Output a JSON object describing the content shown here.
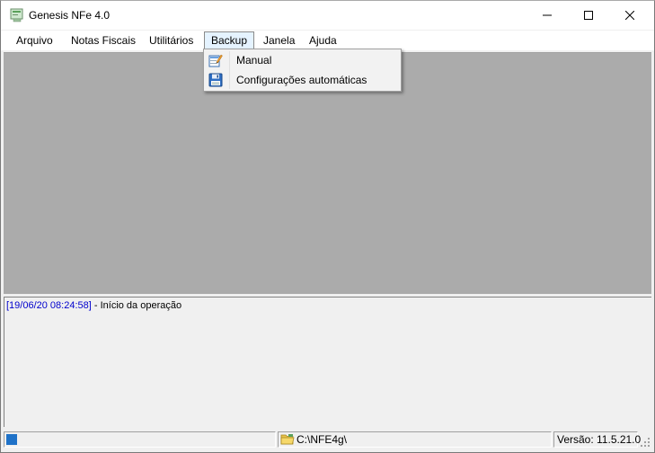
{
  "window": {
    "title": "Genesis NFe 4.0"
  },
  "menubar": {
    "items": [
      {
        "label": "Arquivo"
      },
      {
        "label": "Notas Fiscais"
      },
      {
        "label": "Utilitários"
      },
      {
        "label": "Backup"
      },
      {
        "label": "Janela"
      },
      {
        "label": "Ajuda"
      }
    ],
    "active": "Backup"
  },
  "backup_menu": {
    "items": [
      {
        "label": "Manual",
        "icon": "edit-document-icon"
      },
      {
        "label": "Configurações automáticas",
        "icon": "floppy-disk-icon"
      }
    ]
  },
  "log": {
    "lines": [
      {
        "timestamp": "[19/06/20 08:24:58]",
        "message": " - Início da operação"
      }
    ],
    "timestamp_color": "#0000cc"
  },
  "statusbar": {
    "path": "C:\\NFE4g\\",
    "version": "Versão: 11.5.21.0"
  },
  "colors": {
    "mdi_background": "#ababab",
    "menu_highlight": "#e5f3ff"
  }
}
